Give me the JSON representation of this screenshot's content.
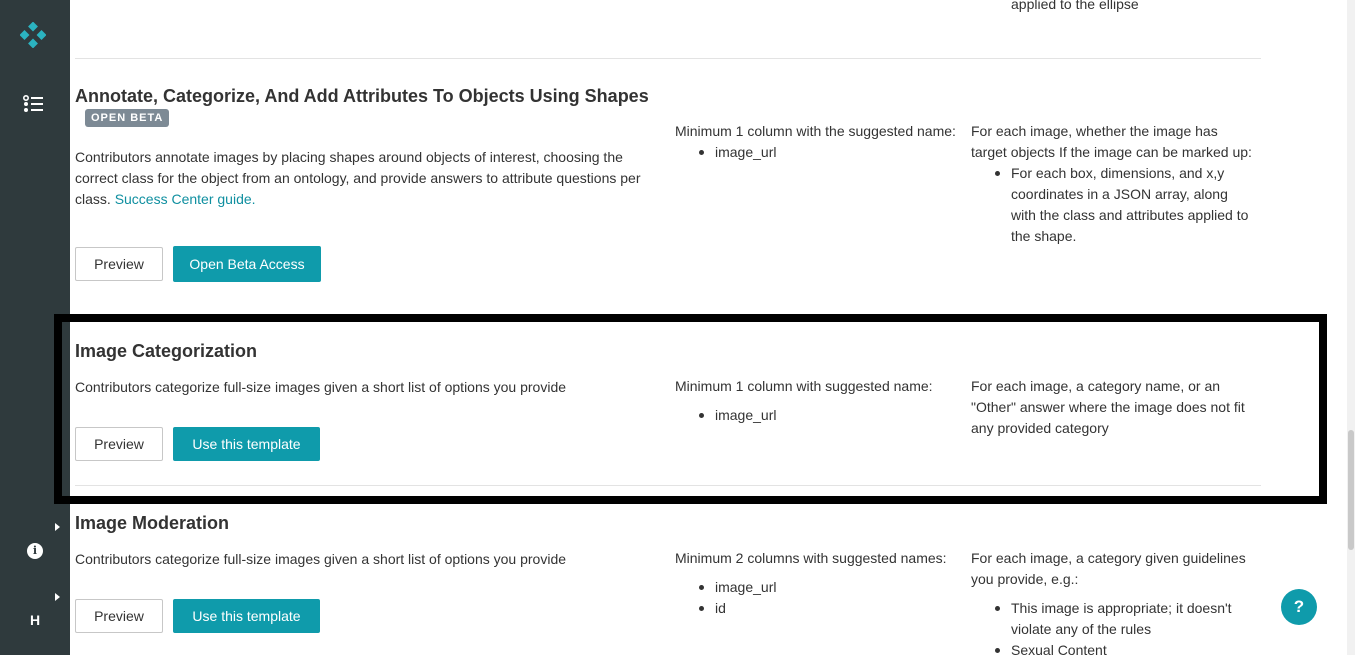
{
  "sidebar": {
    "logo_icon": "diamond-logo-icon",
    "list_icon": "task-list-icon",
    "info_icon": "info-icon",
    "info_glyph": "i",
    "user_initial": "H"
  },
  "prev_item": {
    "trailing_text": "applied to the ellipse"
  },
  "templates": [
    {
      "title": "Annotate, Categorize, And Add Attributes To Objects Using Shapes",
      "badge": "OPEN BETA",
      "description": "Contributors annotate images by placing shapes around objects of interest, choosing the correct class for the object from an ontology, and provide answers to attribute questions per class.",
      "link_text": "Success Center guide.",
      "input_text": "Minimum 1 column with the suggested name:",
      "input_fields": [
        "image_url"
      ],
      "output_text": "For each image, whether the image has target objects If the image can be marked up:",
      "output_items": [
        "For each box, dimensions, and x,y coordinates in a JSON array, along with the class and attributes applied to the shape."
      ],
      "preview_label": "Preview",
      "action_label": "Open Beta Access"
    },
    {
      "title": "Image Categorization",
      "description": "Contributors categorize full-size images given a short list of options you provide",
      "input_text": "Minimum 1 column with suggested name:",
      "input_fields": [
        "image_url"
      ],
      "output_text": "For each image, a category name, or an \"Other\" answer where the image does not fit any provided category",
      "preview_label": "Preview",
      "action_label": "Use this template"
    },
    {
      "title": "Image Moderation",
      "description": "Contributors categorize full-size images given a short list of options you provide",
      "input_text": "Minimum 2 columns with suggested names:",
      "input_fields": [
        "image_url",
        "id"
      ],
      "output_text": "For each image, a category given guidelines you provide, e.g.:",
      "output_items": [
        "This image is appropriate; it doesn't violate any of the rules",
        "Sexual Content"
      ],
      "preview_label": "Preview",
      "action_label": "Use this template"
    }
  ],
  "help_button": {
    "label": "?",
    "icon": "help-icon"
  },
  "colors": {
    "accent": "#0f9bab",
    "sidebar": "#2f3a3d",
    "badge": "#7d8a95",
    "link": "#0f8fa0",
    "highlight_border": "#000000"
  }
}
